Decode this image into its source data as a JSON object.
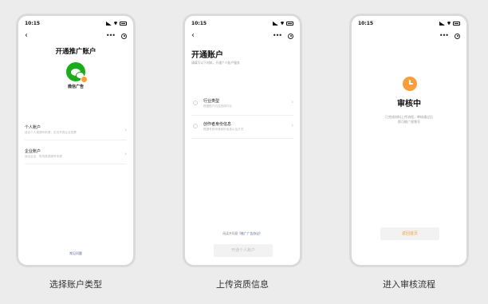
{
  "status_bar": {
    "time": "10:15"
  },
  "screen1": {
    "title": "开通推广账户",
    "logo_caption": "微信广告",
    "accounts": [
      {
        "name": "个人账户",
        "desc": "适合个人视频号申请，无法开具企业发票"
      },
      {
        "name": "企业账户",
        "desc": "适合企业、机构类视频号申请"
      }
    ],
    "footer_link": "常见问题"
  },
  "screen2": {
    "title": "开通账户",
    "subtitle": "请填写以下材料，开通个人账户服务",
    "steps": [
      {
        "name": "行业类型",
        "desc": "根据账户内容选择行业"
      },
      {
        "name": "创作者身份信息",
        "desc": "根据号的申请身份信息以及方式"
      }
    ],
    "agreement_prefix": "阅读并同意",
    "agreement_link": "《推广广告协议》",
    "submit_label": "开通个人账户"
  },
  "screen3": {
    "title": "审核中",
    "desc_line1": "已完成材料上传流程，审核通过后",
    "desc_line2": "即可推广视频号",
    "button_label": "返回首页"
  },
  "captions": [
    "选择账户类型",
    "上传资质信息",
    "进入审核流程"
  ],
  "colors": {
    "wechat_green": "#1aad19",
    "accent_orange": "#fa9d3b",
    "link_blue": "#576b95"
  }
}
